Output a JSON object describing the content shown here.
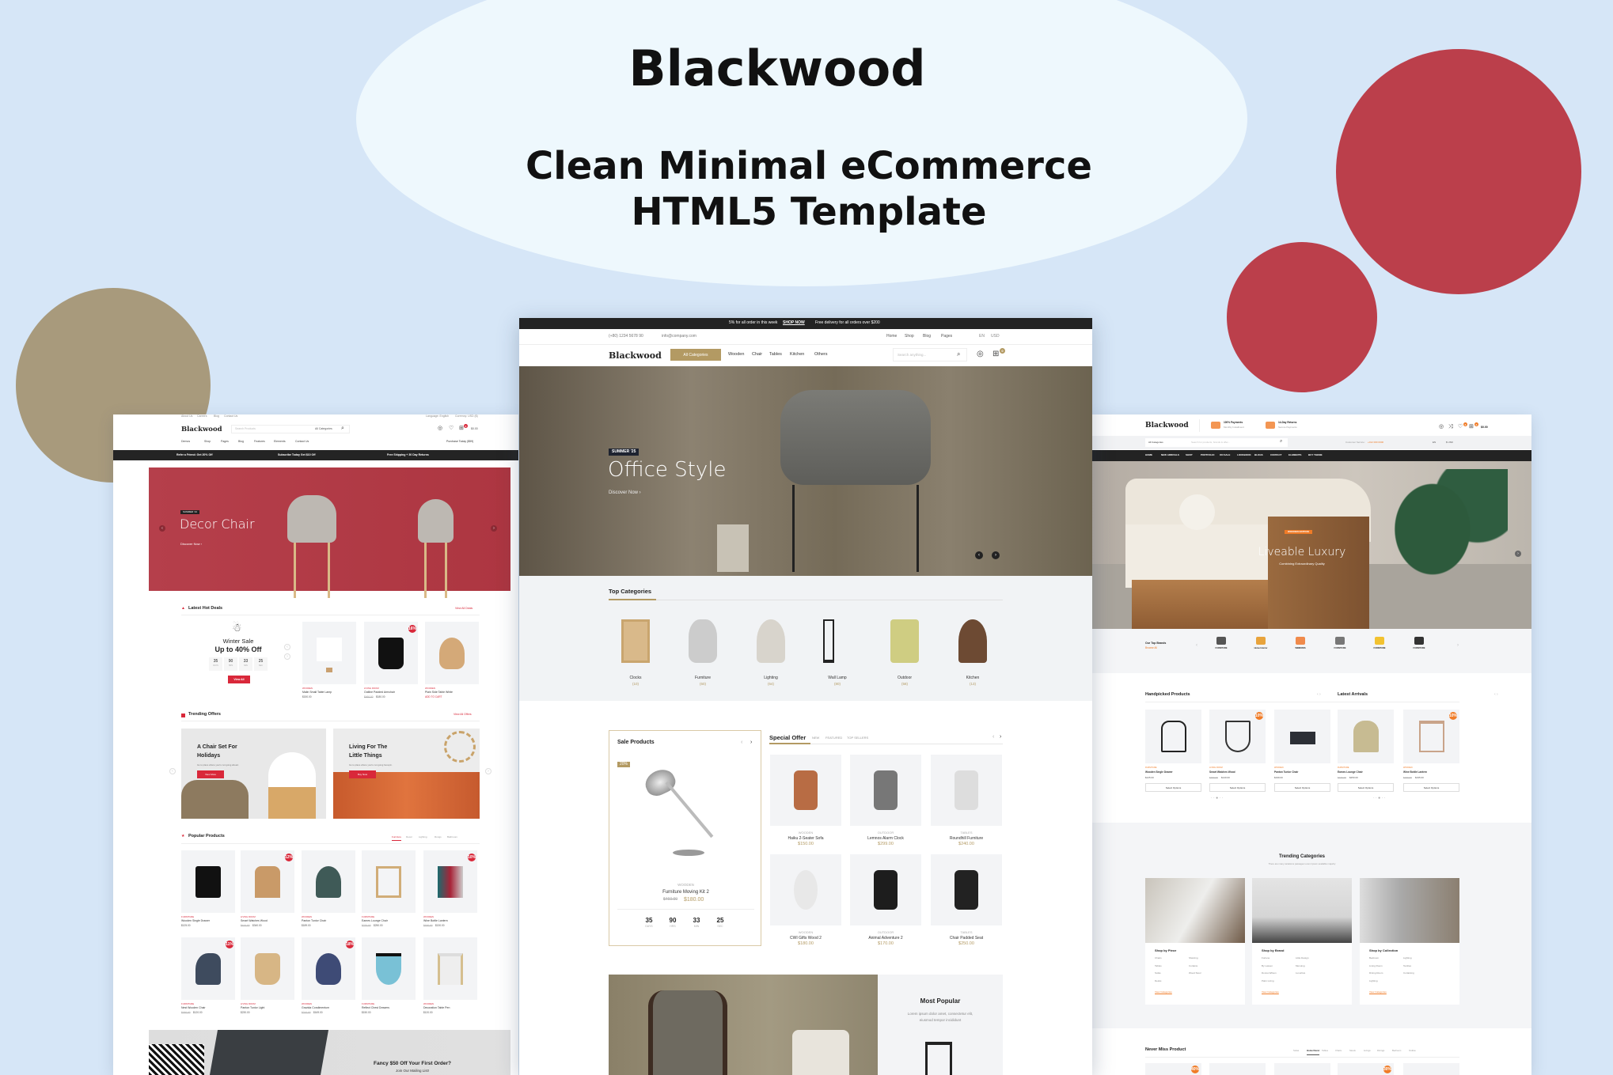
{
  "colors": {
    "background": "#d6e6f7",
    "oval": "#eef8fd",
    "red_circle": "#bb3f4b",
    "tan_circle": "#a89a7c",
    "gold_accent": "#b39a63",
    "red_accent": "#d9283a",
    "orange_accent": "#f07c28"
  },
  "banner": {
    "title": "Blackwood",
    "subtitle_line1": "Clean Minimal eCommerce",
    "subtitle_line2": "HTML5 Template"
  },
  "center": {
    "topbar": {
      "promo": "5% for all order in this week",
      "promo_link": "SHOP NOW",
      "delivery": "Free delivery for all orders over $200"
    },
    "contact": {
      "phone": "(+80) 1234 5678 90",
      "email": "info@company.com"
    },
    "top_nav": [
      "Home",
      "Shop",
      "Blog",
      "Pages"
    ],
    "lang": "EN",
    "currency": "USD",
    "logo": "Blackwood",
    "all_categories": "All Categories",
    "nav": [
      "Wooden",
      "Chair",
      "Tables",
      "Kitchen",
      "Others"
    ],
    "search_placeholder": "Search anything...",
    "cart_count": "0",
    "hero": {
      "badge": "SUMMER '25",
      "title": "Office Style",
      "cta": "Discover Now"
    },
    "top_categories": {
      "title": "Top Categories",
      "items": [
        {
          "name": "Clocks",
          "count": "(10)"
        },
        {
          "name": "Furniture",
          "count": "(60)"
        },
        {
          "name": "Lighting",
          "count": "(64)"
        },
        {
          "name": "Wall Lamp",
          "count": "(80)"
        },
        {
          "name": "Outdoor",
          "count": "(58)"
        },
        {
          "name": "Kitchen",
          "count": "(13)"
        }
      ]
    },
    "sale": {
      "title": "Sale Products",
      "badge": "20%",
      "category": "WOODEN",
      "name": "Furniture Moving Kit 2",
      "old_price": "$460.00",
      "price": "$180.00",
      "countdown": [
        {
          "value": "35",
          "label": "DAYS"
        },
        {
          "value": "90",
          "label": "HRS"
        },
        {
          "value": "33",
          "label": "MIN"
        },
        {
          "value": "25",
          "label": "SEC"
        }
      ]
    },
    "special": {
      "title": "Special Offer",
      "tabs": [
        "NEW",
        "FEATURED",
        "TOP SELLERS"
      ],
      "products": [
        {
          "cat": "WOODEN",
          "name": "Haiku 2-Seater Sofa",
          "price": "$150.00"
        },
        {
          "cat": "OUTDOOR",
          "name": "Lemnos Alarm Clock",
          "price": "$299.00"
        },
        {
          "cat": "TABLES",
          "name": "Roundhill Furniture",
          "price": "$240.00"
        },
        {
          "cat": "WOODEN",
          "name": "CWI Gifts Wood 2",
          "price": "$180.00"
        },
        {
          "cat": "OUTDOOR",
          "name": "Animal Adventure 2",
          "price": "$170.00"
        },
        {
          "cat": "TABLES",
          "name": "Chair Padded Seat",
          "price": "$250.00"
        }
      ]
    },
    "most_popular": {
      "title": "Most Popular",
      "text_line1": "Lorem ipsum dolor amet, consectetur elit,",
      "text_line2": "eiusmod tempor incididunt"
    }
  },
  "left": {
    "top_links": [
      "About Us",
      "Careers",
      "Blog",
      "Contact Us"
    ],
    "language": "Language: English",
    "currency": "Currency: USD ($)",
    "logo": "Blackwood",
    "search_placeholder": "Search Products",
    "categories": "All Categories",
    "cart_total": "$0.00",
    "cart_count": "0",
    "menu": [
      "Demos",
      "Shop",
      "Pages",
      "Blog",
      "Features",
      "Elements",
      "Contact Us"
    ],
    "purchase": "Purchase Today ($59)",
    "promo_bar": [
      "Refer a Friend: Get 20% Off",
      "Subscribe Today Get $10 Off",
      "Free Shipping + 30 Day Returns"
    ],
    "hero": {
      "badge": "SUMMER '21",
      "title": "Decor Chair",
      "cta": "Discover Now"
    },
    "hot_deals": {
      "title": "Latest Hot Deals",
      "view_all": "View All Deals",
      "sale_title": "Winter Sale",
      "sale_sub": "Up to 40% Off",
      "countdown": [
        {
          "value": "35",
          "label": "DAYS"
        },
        {
          "value": "90",
          "label": "HRS"
        },
        {
          "value": "33",
          "label": "MIN"
        },
        {
          "value": "25",
          "label": "SEC"
        }
      ],
      "button": "View All",
      "products": [
        {
          "cat": "WOODEN",
          "name": "Malin Small Table Lamp",
          "price": "$150.00"
        },
        {
          "cat": "LIVING ROOM",
          "name": "Outline Padded Armchair",
          "old": "$460.00",
          "price": "$180.00",
          "badge": "16%"
        },
        {
          "cat": "WOODEN",
          "name": "Plain Side Table White",
          "price": "ADD TO CART"
        }
      ]
    },
    "trending": {
      "title": "Trending Offers",
      "view_all": "View All Offers",
      "banners": [
        {
          "title1": "A Chair Set For",
          "title2": "Holidays",
          "text": "Go to place where you're not going ahead.",
          "button": "View More"
        },
        {
          "title1": "Living For The",
          "title2": "Little Things",
          "text": "Go to place where you're not going hecepin.",
          "button": "Buy Now"
        }
      ]
    },
    "popular": {
      "title": "Popular Products",
      "tabs": [
        "Furniture",
        "Decor",
        "Lighting",
        "Rungs",
        "Bathroom"
      ],
      "products": [
        {
          "cat": "FURNITURE",
          "name": "Wooden Single Drawer",
          "price": "$125.00"
        },
        {
          "cat": "LIVING ROOM",
          "name": "Smart Watches Wood",
          "old": "$410.00",
          "price": "$340.00",
          "badge": "12%"
        },
        {
          "cat": "WOODEN",
          "name": "Panton Tunior Chair",
          "price": "$189.00"
        },
        {
          "cat": "FURNITURE",
          "name": "Eames Lounge Chair",
          "old": "$270.00",
          "price": "$250.00"
        },
        {
          "cat": "WOODEN",
          "name": "Wine Bottle Lantern",
          "old": "$150.00",
          "price": "$130.00",
          "badge": "10%"
        },
        {
          "cat": "FURNITURE",
          "name": "Nest Wooden Chair",
          "old": "$180.00",
          "price": "$120.00",
          "badge": "11%"
        },
        {
          "cat": "LIVING ROOM",
          "name": "Panton Tunior Light",
          "price": "$230.00"
        },
        {
          "cat": "WOODEN",
          "name": "Gravida Condimentum",
          "old": "$210.00",
          "price": "$169.00",
          "badge": "18%"
        },
        {
          "cat": "FURNITURE",
          "name": "Reflect Chest Drawers",
          "price": "$150.00"
        },
        {
          "cat": "WOODEN",
          "name": "Decoration Table Pen",
          "price": "$120.00"
        }
      ]
    },
    "newsletter": {
      "title": "Fancy $50 Off Your First Order?",
      "text": "Join Our Mailing List!"
    }
  },
  "right": {
    "logo": "Blackwood",
    "features": [
      {
        "title": "100% Payments",
        "sub": "Monthly Installment"
      },
      {
        "title": "14-Day Returns",
        "sub": "Secure Payments"
      }
    ],
    "wishlist_count": "0",
    "cart_count": "0",
    "cart_total": "$0.00",
    "category_select": "All Categories",
    "search_placeholder": "Search for products, brands & offer...",
    "customer_label": "Customer Service:",
    "customer_phone": "+012 000 0000",
    "lang": "EN",
    "currency": "$ USD",
    "menu": [
      "HOME",
      "NEW ARRIVALS",
      "SHOP",
      "PORTFOLIO",
      "ON SALE",
      "LOOKBOOK",
      "BLOGS",
      "CONTACT",
      "ELEMENTS",
      "BUY THEME"
    ],
    "hero": {
      "badge": "WOODEN EDITION",
      "title": "Liveable Luxury",
      "sub": "Combining Extraordinary Quality"
    },
    "brands": {
      "title": "Our Top Brands",
      "link": "Browse All",
      "items": [
        "FURNITURE",
        "Home Interior",
        "WINDOWS",
        "FURNITURE",
        "FURNITURE",
        "FURNITURE"
      ]
    },
    "handpicked_title": "Handpicked Products",
    "latest_title": "Latest Arrivals",
    "button": "Select Options",
    "products": [
      {
        "cat": "FURNITURE",
        "name": "Wooden Single Drawer",
        "price": "$125.00"
      },
      {
        "cat": "LIVING ROOM",
        "name": "Smart Watches Wood",
        "old": "$150.00",
        "price": "$140.00",
        "badge": "10%"
      },
      {
        "cat": "WOODEN",
        "name": "Panton Tunior Chair",
        "price": "$199.00"
      },
      {
        "cat": "FURNITURE",
        "name": "Eames Lounge Chair",
        "old": "$270.00",
        "price": "$250.00"
      },
      {
        "cat": "WOODEN",
        "name": "Wine Bottle Lantern",
        "old": "$160.00",
        "price": "$195.00",
        "badge": "10%"
      }
    ],
    "trending": {
      "title": "Trending Categories",
      "sub": "There are many variations passages Lorem Ipsum available majority",
      "link": "View Categories",
      "cards": [
        {
          "title": "Shop by Piece",
          "col1": [
            "Chairs",
            "Tables",
            "Sofas",
            "Desks"
          ],
          "col2": [
            "Shelving",
            "Curtains",
            "Wood Stool"
          ]
        },
        {
          "title": "Shop by Brand",
          "col1": [
            "Fortune",
            "By Lassen",
            "Donna Wilson",
            "Palm Living"
          ],
          "col2": [
            "Little Design",
            "Menuing",
            "Luxurilva"
          ]
        },
        {
          "title": "Shop by Collection",
          "col1": [
            "Bedroom",
            "Living Room",
            "Dining Room",
            "Lighting"
          ],
          "col2": [
            "Lighting",
            "Textiles",
            "Curtaining"
          ]
        }
      ]
    },
    "never_miss": {
      "title": "Never Miss Product",
      "tabs": [
        "Sofas",
        "Home Decor",
        "Tables",
        "Chairs",
        "Stools",
        "Livings",
        "Dinings",
        "Bedroom",
        "Outline"
      ],
      "active_tab": 1,
      "badges": [
        "40%",
        "",
        "",
        "30%",
        ""
      ]
    }
  }
}
